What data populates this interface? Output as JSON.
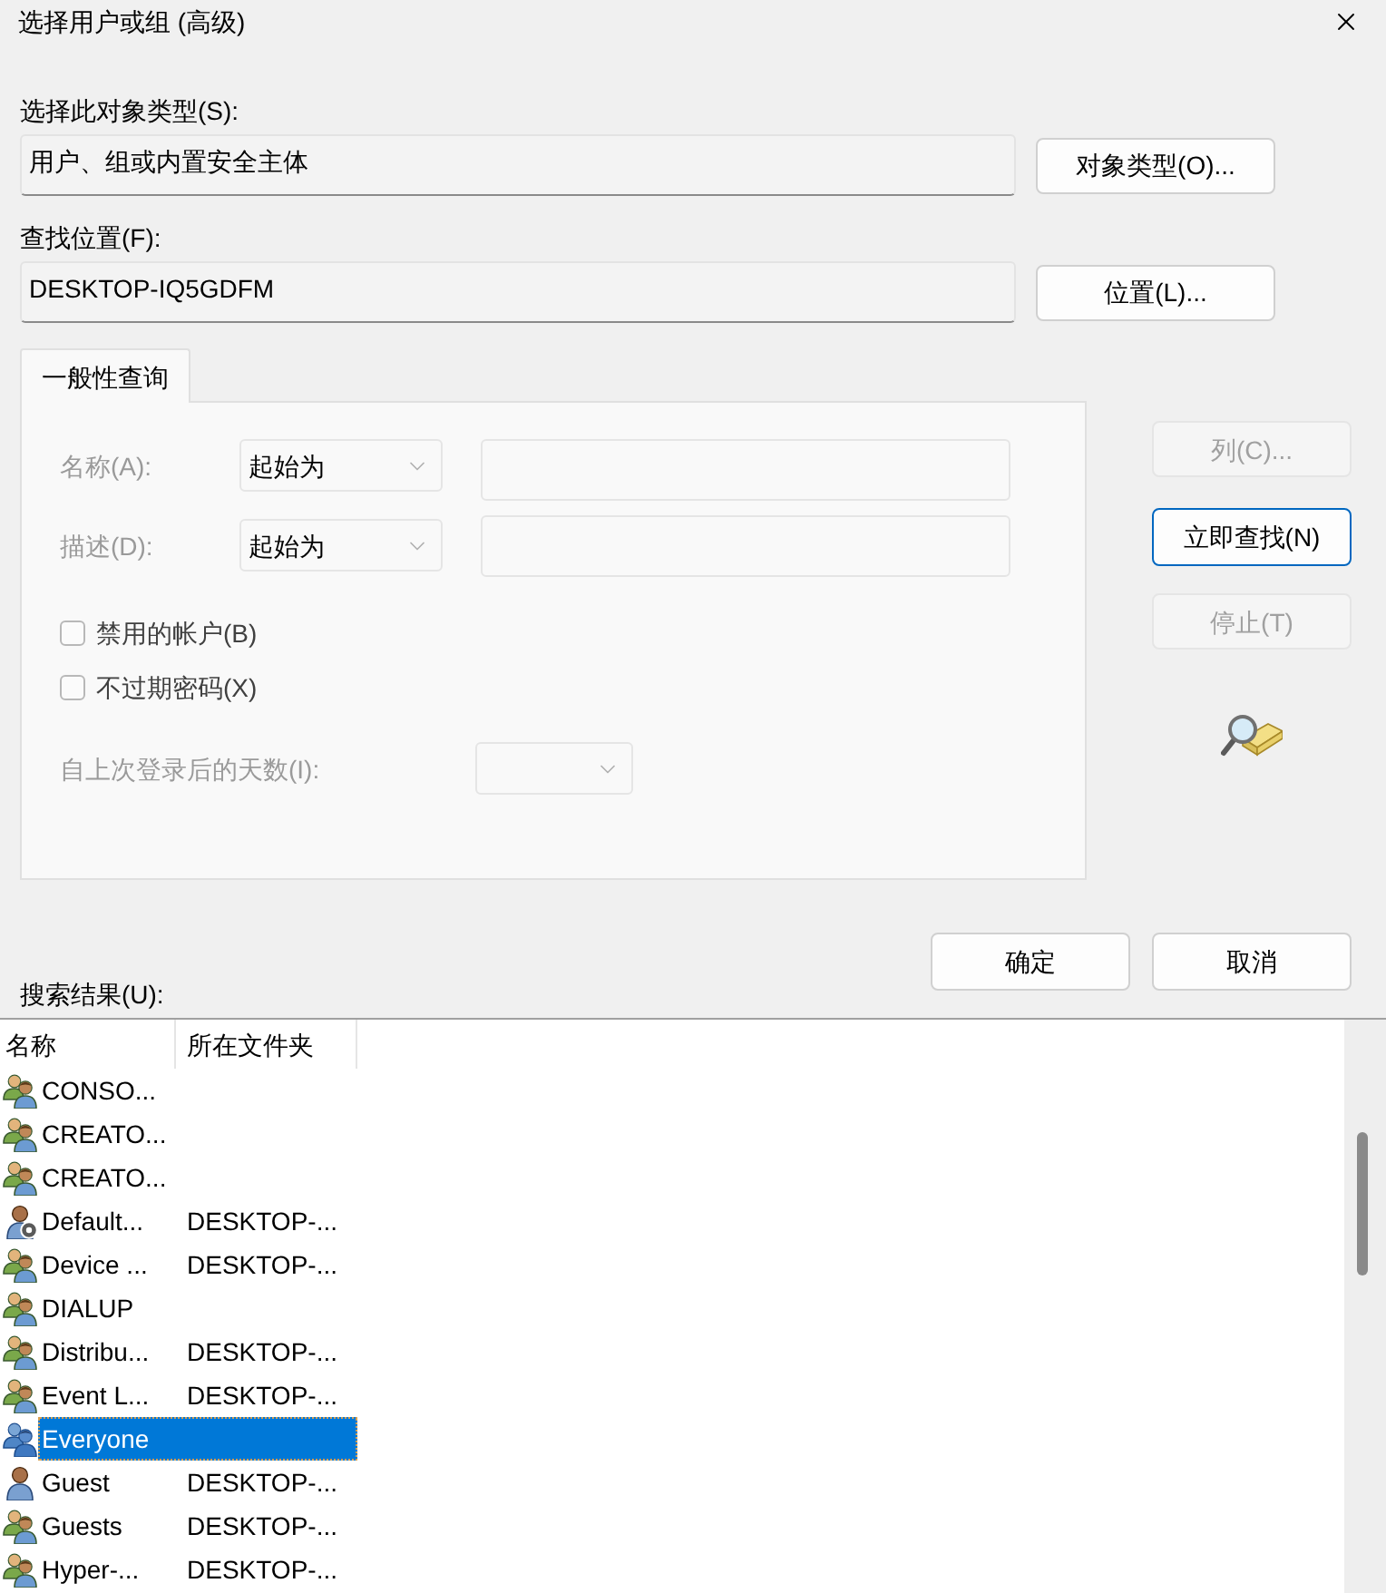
{
  "window": {
    "title": "选择用户或组 (高级)"
  },
  "object_type": {
    "label": "选择此对象类型(S):",
    "value": "用户、组或内置安全主体",
    "button": "对象类型(O)..."
  },
  "location": {
    "label": "查找位置(F):",
    "value": "DESKTOP-IQ5GDFM",
    "button": "位置(L)..."
  },
  "tabs": [
    {
      "label": "一般性查询",
      "selected": true
    }
  ],
  "query": {
    "fields": [
      {
        "label": "名称(A):",
        "operator": "起始为",
        "disabled": true
      },
      {
        "label": "描述(D):",
        "operator": "起始为",
        "disabled": true
      }
    ],
    "checkboxes": [
      {
        "label": "禁用的帐户(B)",
        "checked": false
      },
      {
        "label": "不过期密码(X)",
        "checked": false
      }
    ],
    "days": {
      "label": "自上次登录后的天数(I):",
      "disabled": true
    }
  },
  "side_buttons": [
    {
      "label": "列(C)...",
      "disabled": true,
      "default": false
    },
    {
      "label": "立即查找(N)",
      "disabled": false,
      "default": true
    },
    {
      "label": "停止(T)",
      "disabled": true,
      "default": false
    }
  ],
  "dialog_buttons": [
    "确定",
    "取消"
  ],
  "results": {
    "label": "搜索结果(U):",
    "columns": [
      "名称",
      "所在文件夹"
    ],
    "rows": [
      {
        "name": "CONSO...",
        "kind": "group",
        "selected": false
      },
      {
        "name": "CREATO...",
        "kind": "group",
        "selected": false
      },
      {
        "name": "CREATO...",
        "kind": "group",
        "selected": false
      },
      {
        "name": "Default...",
        "folder": "DESKTOP-...",
        "kind": "managed-user",
        "selected": false
      },
      {
        "name": "Device ...",
        "folder": "DESKTOP-...",
        "kind": "group",
        "selected": false
      },
      {
        "name": "DIALUP",
        "kind": "group",
        "selected": false
      },
      {
        "name": "Distribu...",
        "folder": "DESKTOP-...",
        "kind": "group",
        "selected": false
      },
      {
        "name": "Event L...",
        "folder": "DESKTOP-...",
        "kind": "group",
        "selected": false
      },
      {
        "name": "Everyone",
        "kind": "group",
        "selected": true
      },
      {
        "name": "Guest",
        "folder": "DESKTOP-...",
        "kind": "user",
        "selected": false
      },
      {
        "name": "Guests",
        "folder": "DESKTOP-...",
        "kind": "group",
        "selected": false
      },
      {
        "name": "Hyper-...",
        "folder": "DESKTOP-...",
        "kind": "group",
        "selected": false
      }
    ]
  }
}
